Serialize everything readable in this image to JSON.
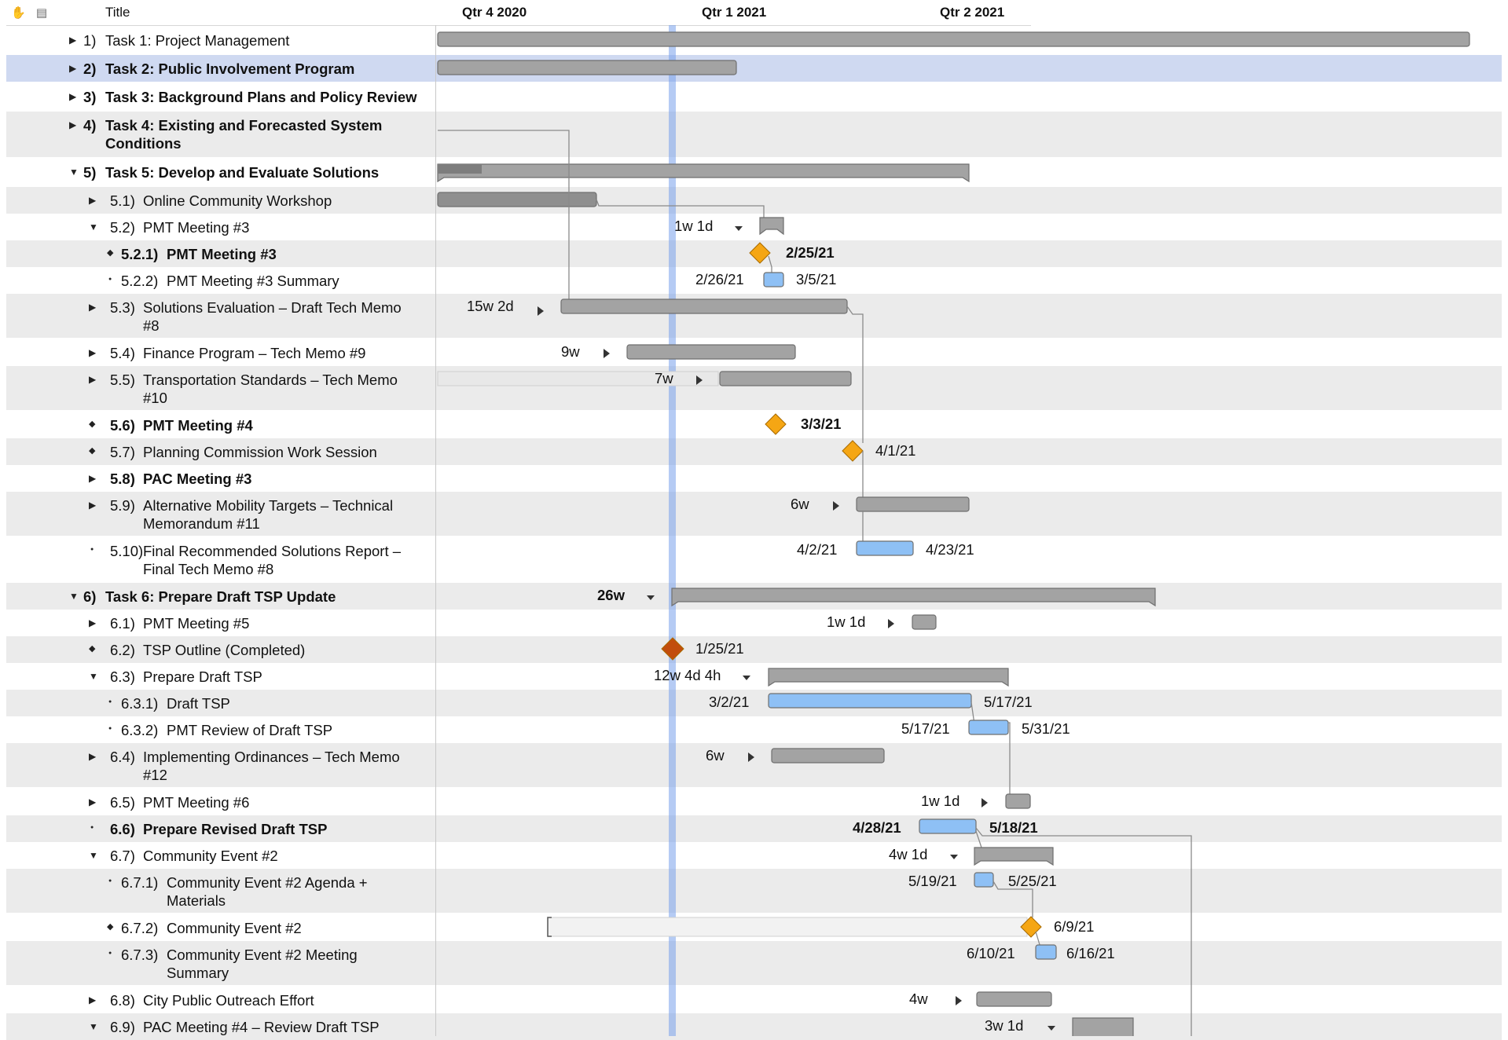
{
  "header": {
    "title_label": "Title",
    "quarters": [
      "Qtr 4 2020",
      "Qtr 1 2021",
      "Qtr 2 2021"
    ]
  },
  "colors": {
    "alt_row": "#ebebeb",
    "selected_row": "#cfd9f1",
    "bar_gray": "#a3a3a3",
    "bar_blue": "#8ec0f5",
    "milestone": "#f5a614",
    "milestone_done": "#c24d0c",
    "today_line": "#9fbff0"
  },
  "rows": [
    {
      "num": "1)",
      "title": "Task 1: Project Management",
      "expander": "collapsed",
      "bold": false
    },
    {
      "num": "2)",
      "title": "Task 2: Public Involvement Program",
      "expander": "collapsed",
      "bold": true,
      "selected": true
    },
    {
      "num": "3)",
      "title": "Task 3: Background Plans and Policy Review",
      "expander": "collapsed",
      "bold": true
    },
    {
      "num": "4)",
      "title": "Task 4: Existing and Forecasted System\nConditions",
      "expander": "collapsed",
      "bold": true
    },
    {
      "num": "5)",
      "title": "Task 5: Develop and Evaluate Solutions",
      "expander": "expanded",
      "bold": true
    },
    {
      "num": "5.1)",
      "title": "Online Community Workshop",
      "expander": "collapsed",
      "bold": false
    },
    {
      "num": "5.2)",
      "title": "PMT Meeting #3",
      "expander": "expanded",
      "bold": false
    },
    {
      "num": "5.2.1)",
      "title": "PMT Meeting #3",
      "expander": "milestone",
      "bold": true
    },
    {
      "num": "5.2.2)",
      "title": "PMT Meeting #3 Summary",
      "expander": "task",
      "bold": false
    },
    {
      "num": "5.3)",
      "title": "Solutions Evaluation – Draft Tech Memo\n#8",
      "expander": "collapsed",
      "bold": false
    },
    {
      "num": "5.4)",
      "title": "Finance Program – Tech Memo #9",
      "expander": "collapsed",
      "bold": false
    },
    {
      "num": "5.5)",
      "title": "Transportation Standards – Tech Memo\n#10",
      "expander": "collapsed",
      "bold": false
    },
    {
      "num": "5.6)",
      "title": "PMT Meeting #4",
      "expander": "milestone",
      "bold": true
    },
    {
      "num": "5.7)",
      "title": "Planning Commission Work Session",
      "expander": "milestone",
      "bold": false
    },
    {
      "num": "5.8)",
      "title": "PAC Meeting #3",
      "expander": "collapsed",
      "bold": true
    },
    {
      "num": "5.9)",
      "title": "Alternative Mobility Targets – Technical\nMemorandum #11",
      "expander": "collapsed",
      "bold": false
    },
    {
      "num": "5.10)",
      "title": "Final Recommended Solutions Report –\nFinal Tech Memo #8",
      "expander": "task",
      "bold": false
    },
    {
      "num": "6)",
      "title": "Task 6: Prepare Draft TSP Update",
      "expander": "expanded",
      "bold": true
    },
    {
      "num": "6.1)",
      "title": "PMT Meeting #5",
      "expander": "collapsed",
      "bold": false
    },
    {
      "num": "6.2)",
      "title": "TSP Outline (Completed)",
      "expander": "milestone",
      "bold": false
    },
    {
      "num": "6.3)",
      "title": "Prepare Draft TSP",
      "expander": "expanded",
      "bold": false
    },
    {
      "num": "6.3.1)",
      "title": "Draft TSP",
      "expander": "task",
      "bold": false
    },
    {
      "num": "6.3.2)",
      "title": "PMT Review of Draft TSP",
      "expander": "task",
      "bold": false
    },
    {
      "num": "6.4)",
      "title": "Implementing Ordinances – Tech Memo\n#12",
      "expander": "collapsed",
      "bold": false
    },
    {
      "num": "6.5)",
      "title": "PMT Meeting #6",
      "expander": "collapsed",
      "bold": false
    },
    {
      "num": "6.6)",
      "title": "Prepare Revised Draft TSP",
      "expander": "task",
      "bold": true
    },
    {
      "num": "6.7)",
      "title": "Community Event #2",
      "expander": "expanded",
      "bold": false
    },
    {
      "num": "6.7.1)",
      "title": "Community Event #2 Agenda +\nMaterials",
      "expander": "task",
      "bold": false
    },
    {
      "num": "6.7.2)",
      "title": "Community Event #2",
      "expander": "milestone",
      "bold": false
    },
    {
      "num": "6.7.3)",
      "title": "Community Event #2 Meeting\nSummary",
      "expander": "task",
      "bold": false
    },
    {
      "num": "6.8)",
      "title": "City Public Outreach Effort",
      "expander": "collapsed",
      "bold": false
    },
    {
      "num": "6.9)",
      "title": "PAC Meeting #4 – Review Draft TSP",
      "expander": "expanded",
      "bold": false
    }
  ],
  "gantt_labels": [
    {
      "row": 6,
      "text": "1w 1d"
    },
    {
      "row": 7,
      "text": "2/25/21"
    },
    {
      "row": 8,
      "text": "2/26/21"
    },
    {
      "row": 8,
      "text": "3/5/21"
    },
    {
      "row": 9,
      "text": "15w 2d"
    },
    {
      "row": 10,
      "text": "9w"
    },
    {
      "row": 11,
      "text": "7w"
    },
    {
      "row": 12,
      "text": "3/3/21"
    },
    {
      "row": 13,
      "text": "4/1/21"
    },
    {
      "row": 15,
      "text": "6w"
    },
    {
      "row": 16,
      "text": "4/2/21"
    },
    {
      "row": 16,
      "text": "4/23/21"
    },
    {
      "row": 17,
      "text": "26w"
    },
    {
      "row": 18,
      "text": "1w 1d"
    },
    {
      "row": 19,
      "text": "1/25/21"
    },
    {
      "row": 20,
      "text": "12w 4d 4h"
    },
    {
      "row": 21,
      "text": "3/2/21"
    },
    {
      "row": 21,
      "text": "5/17/21"
    },
    {
      "row": 22,
      "text": "5/17/21"
    },
    {
      "row": 22,
      "text": "5/31/21"
    },
    {
      "row": 23,
      "text": "6w"
    },
    {
      "row": 24,
      "text": "1w 1d"
    },
    {
      "row": 25,
      "text": "4/28/21"
    },
    {
      "row": 25,
      "text": "5/18/21"
    },
    {
      "row": 26,
      "text": "4w 1d"
    },
    {
      "row": 27,
      "text": "5/19/21"
    },
    {
      "row": 27,
      "text": "5/25/21"
    },
    {
      "row": 28,
      "text": "6/9/21"
    },
    {
      "row": 29,
      "text": "6/10/21"
    },
    {
      "row": 29,
      "text": "6/16/21"
    },
    {
      "row": 30,
      "text": "4w"
    },
    {
      "row": 31,
      "text": "3w 1d"
    }
  ]
}
